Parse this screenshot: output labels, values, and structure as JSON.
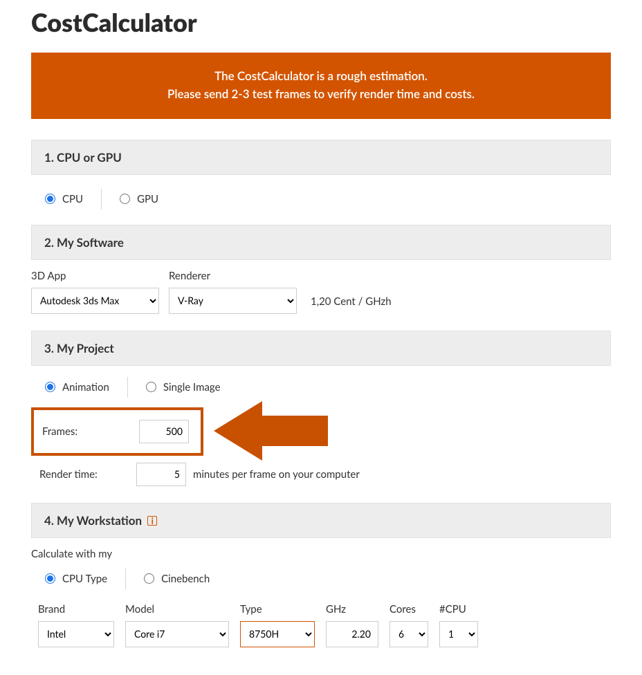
{
  "title": "CostCalculator",
  "banner": {
    "line1": "The CostCalculator is a rough estimation.",
    "line2": "Please send 2-3 test frames to verify render time and costs."
  },
  "section1": {
    "title": "1. CPU or GPU",
    "opt_cpu": "CPU",
    "opt_gpu": "GPU"
  },
  "section2": {
    "title": "2. My Software",
    "app_label": "3D App",
    "renderer_label": "Renderer",
    "app_value": "Autodesk 3ds Max",
    "renderer_value": "V-Ray",
    "price_text": "1,20 Cent / GHzh"
  },
  "section3": {
    "title": "3. My Project",
    "opt_animation": "Animation",
    "opt_single": "Single Image",
    "frames_label": "Frames:",
    "frames_value": "500",
    "rendertime_label": "Render time:",
    "rendertime_value": "5",
    "rendertime_hint": "minutes per frame on your computer"
  },
  "section4": {
    "title": "4. My Workstation",
    "calc_with_label": "Calculate with my",
    "opt_cputype": "CPU Type",
    "opt_cinebench": "Cinebench",
    "brand_label": "Brand",
    "model_label": "Model",
    "type_label": "Type",
    "ghz_label": "GHz",
    "cores_label": "Cores",
    "ncpu_label": "#CPU",
    "brand_value": "Intel",
    "model_value": "Core i7",
    "type_value": "8750H",
    "ghz_value": "2.20",
    "cores_value": "6",
    "ncpu_value": "1"
  },
  "colors": {
    "accent": "#d35400",
    "arrow": "#c75100"
  }
}
